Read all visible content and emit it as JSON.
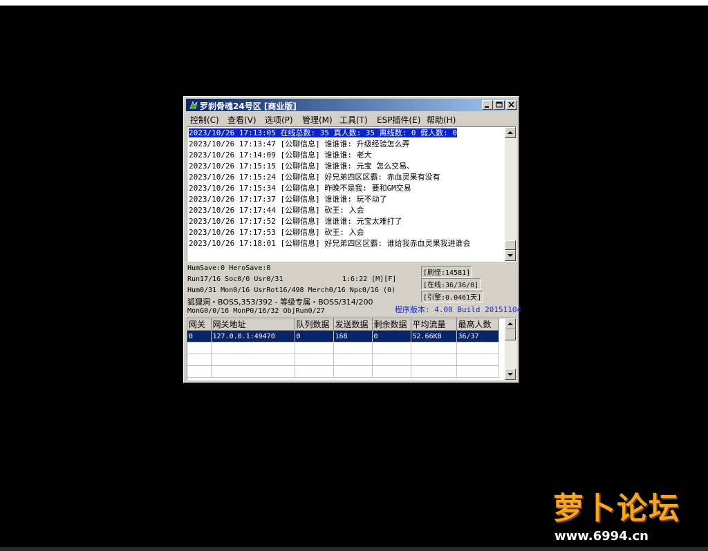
{
  "window": {
    "title": "罗刹骨魂24号区 [商业版]"
  },
  "menu": [
    {
      "label": "控制(C)"
    },
    {
      "label": "查看(V)"
    },
    {
      "label": "选项(P)"
    },
    {
      "label": "管理(M)"
    },
    {
      "label": "工具(T)"
    },
    {
      "label": "ESP插件(E)"
    },
    {
      "label": "帮助(H)"
    }
  ],
  "log_lines": [
    "2023/10/26 17:13:05 在线总数: 35 真人数: 35 离线数: 0 假人数: 0",
    "2023/10/26 17:13:47 [公聊信息] 谁谁谁: 升级经验怎么弄",
    "2023/10/26 17:14:09 [公聊信息] 谁谁谁: 老大",
    "2023/10/26 17:15:15 [公聊信息] 谁谁谁: 元宝 怎么交易、",
    "2023/10/26 17:15:24 [公聊信息] 好兄弟四区区霸: 赤血灵果有没有",
    "2023/10/26 17:15:34 [公聊信息] 昨晚不是我: 要和GM交易",
    "2023/10/26 17:17:37 [公聊信息] 谁谁谁: 玩不动了",
    "2023/10/26 17:17:44 [公聊信息] 砍王: 入会",
    "2023/10/26 17:17:52 [公聊信息] 谁谁谁: 元宝太难打了",
    "2023/10/26 17:17:53 [公聊信息] 砍王: 入会",
    "2023/10/26 17:18:01 [公聊信息] 好兄弟四区区霸: 谁给我赤血灵果我进谁会"
  ],
  "status": {
    "humsave": "HumSave:0 HeroSave:0",
    "run": "Run17/16 Soc0/0 Usr0/31",
    "time": "1:6:22 [M][F]",
    "hum": "Hum0/31 Mon0/16 UsrRot16/498 Merch0/16 Npc0/16 (0)",
    "boss": "狐狸洞・BOSS,353/392 - 等级专属・BOSS/314/200",
    "mon": "MonG0/0/16 MonP0/16/32 ObjRun0/27",
    "refresh": "[刷怪:14581]",
    "online": "[在线:36/36/0]",
    "engine": "[引擎:0.0461天]",
    "version": "程序版本: 4.00 Build 20151104"
  },
  "table": {
    "headers": [
      "网关",
      "网关地址",
      "队列数据",
      "发送数据",
      "剩余数据",
      "平均流量",
      "最高人数"
    ],
    "rows": [
      [
        "0",
        "127.0.0.1:49470",
        "0",
        "168",
        "0",
        "52.66KB",
        "36/37"
      ]
    ]
  },
  "watermark": {
    "logo": "萝卜论坛",
    "url": "www.6994.cn"
  }
}
